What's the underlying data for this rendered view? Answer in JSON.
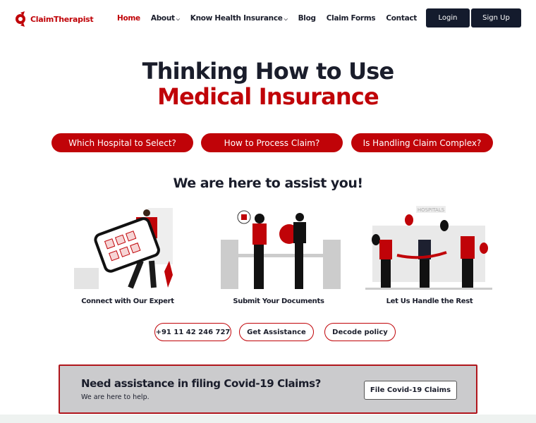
{
  "brand": {
    "name": "ClaimTherapist",
    "accent": "#c00308",
    "dark": "#141b2d"
  },
  "nav": {
    "items": [
      {
        "label": "Home",
        "active": true
      },
      {
        "label": "About",
        "dropdown": true
      },
      {
        "label": "Know Health Insurance",
        "dropdown": true
      },
      {
        "label": "Blog"
      },
      {
        "label": "Claim Forms"
      },
      {
        "label": "Contact"
      }
    ],
    "login": "Login",
    "signup": "Sign Up"
  },
  "hero": {
    "line1": "Thinking How to Use",
    "line2": "Medical Insurance",
    "questions": [
      "Which Hospital to Select?",
      "How to Process Claim?",
      "Is Handling Claim Complex?"
    ]
  },
  "assist": {
    "title": "We are here to assist you!",
    "steps": [
      {
        "caption": "Connect with Our Expert"
      },
      {
        "caption": "Submit Your Documents"
      },
      {
        "caption": "Let Us Handle the Rest",
        "sign": "HOSPITALS"
      }
    ],
    "buttons": [
      "+91 11 42 246 727",
      "Get Assistance",
      "Decode policy"
    ]
  },
  "covid": {
    "title": "Need assistance in filing Covid-19 Claims?",
    "subtitle": "We are here to help.",
    "button": "File Covid-19 Claims"
  }
}
